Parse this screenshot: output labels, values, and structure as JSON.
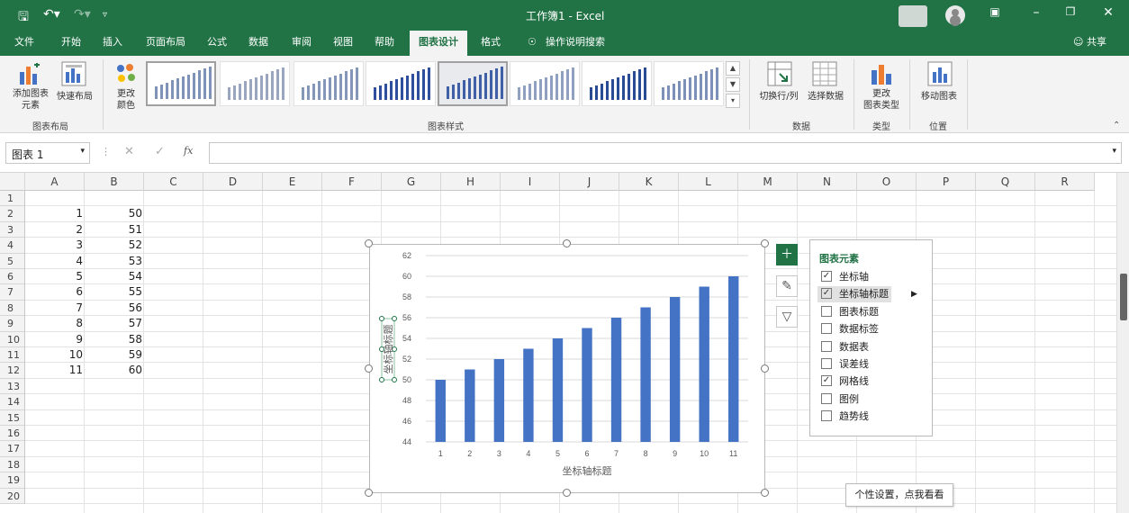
{
  "window": {
    "title": "工作簿1 - Excel",
    "share": "共享"
  },
  "tabs": [
    "文件",
    "开始",
    "插入",
    "页面布局",
    "公式",
    "数据",
    "审阅",
    "视图",
    "帮助",
    "图表设计",
    "格式"
  ],
  "active_tab": "图表设计",
  "tell_me": "操作说明搜索",
  "ribbon": {
    "add_element": "添加图表\n元素",
    "quick_layout": "快速布局",
    "group_layout": "图表布局",
    "change_color": "更改\n颜色",
    "group_styles": "图表样式",
    "switch_row_col": "切换行/列",
    "select_data": "选择数据",
    "group_data": "数据",
    "change_type": "更改\n图表类型",
    "group_type": "类型",
    "move_chart": "移动图表",
    "group_location": "位置"
  },
  "formula_bar": {
    "name_box": "图表 1",
    "fx": "fx"
  },
  "columns": [
    "A",
    "B",
    "C",
    "D",
    "E",
    "F",
    "G",
    "H",
    "I",
    "J",
    "K",
    "L",
    "M",
    "N",
    "O",
    "P",
    "Q",
    "R"
  ],
  "rows": [
    1,
    2,
    3,
    4,
    5,
    6,
    7,
    8,
    9,
    10,
    11,
    12,
    13,
    14,
    15,
    16,
    17,
    18,
    19,
    20
  ],
  "cells": {
    "A": [
      "",
      "1",
      "2",
      "3",
      "4",
      "5",
      "6",
      "7",
      "8",
      "9",
      "10",
      "11"
    ],
    "B": [
      "",
      "50",
      "51",
      "52",
      "53",
      "54",
      "55",
      "56",
      "57",
      "58",
      "59",
      "60"
    ]
  },
  "chart_data": {
    "type": "bar",
    "categories": [
      "1",
      "2",
      "3",
      "4",
      "5",
      "6",
      "7",
      "8",
      "9",
      "10",
      "11"
    ],
    "values": [
      50,
      51,
      52,
      53,
      54,
      55,
      56,
      57,
      58,
      59,
      60
    ],
    "title": "",
    "xlabel": "坐标轴标题",
    "ylabel": "坐标轴标题",
    "ylim": [
      44,
      62
    ],
    "yticks": [
      "44",
      "46",
      "48",
      "50",
      "52",
      "54",
      "56",
      "58",
      "60",
      "62"
    ],
    "grid": true,
    "bar_color": "#4472c4"
  },
  "panel": {
    "title": "图表元素",
    "items": [
      {
        "label": "坐标轴",
        "checked": true
      },
      {
        "label": "坐标轴标题",
        "checked": true
      },
      {
        "label": "图表标题",
        "checked": false
      },
      {
        "label": "数据标签",
        "checked": false
      },
      {
        "label": "数据表",
        "checked": false
      },
      {
        "label": "误差线",
        "checked": false
      },
      {
        "label": "网格线",
        "checked": true
      },
      {
        "label": "图例",
        "checked": false
      },
      {
        "label": "趋势线",
        "checked": false
      }
    ]
  },
  "tooltip": "个性设置，点我看看",
  "colors": {
    "accent": "#217346",
    "bar": "#4472c4"
  }
}
